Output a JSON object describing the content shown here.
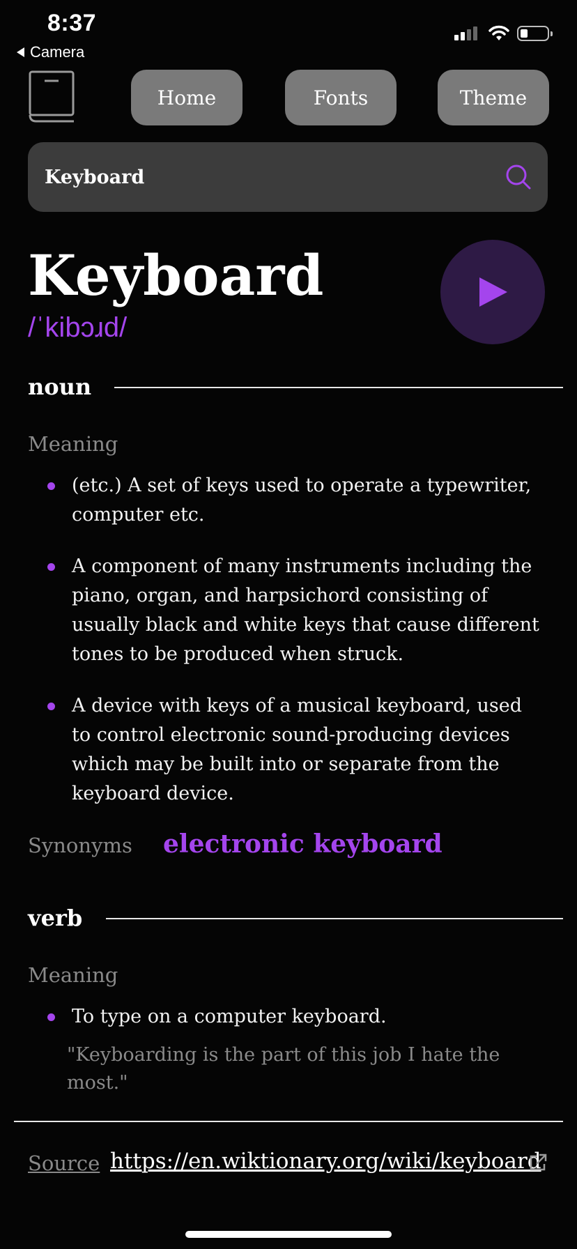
{
  "status_bar": {
    "time": "8:37",
    "back_app": "Camera"
  },
  "nav": {
    "home_label": "Home",
    "fonts_label": "Fonts",
    "theme_label": "Theme"
  },
  "search": {
    "value": "Keyboard"
  },
  "entry": {
    "word": "Keyboard",
    "phonetic": "/ˈkibɔɹd/",
    "meanings": [
      {
        "part_of_speech": "noun",
        "meaning_label": "Meaning",
        "definitions": [
          "(etc.) A set of keys used to operate a typewriter, computer etc.",
          "A component of many instruments including the piano, organ, and harpsichord consisting of usually black and white keys that cause different tones to be produced when struck.",
          "A device with keys of a musical keyboard, used to control electronic sound-producing devices which may be built into or separate from the keyboard device."
        ],
        "synonyms_label": "Synonyms",
        "synonyms": [
          "electronic keyboard"
        ]
      },
      {
        "part_of_speech": "verb",
        "meaning_label": "Meaning",
        "definitions": [
          "To type on a computer keyboard."
        ],
        "example": "\"Keyboarding is the part of this job I hate the most.\""
      }
    ]
  },
  "source": {
    "label": "Source",
    "url": "https://en.wiktionary.org/wiki/keyboard"
  },
  "colors": {
    "accent": "#a445ed",
    "background": "#050505",
    "button": "#7a7a7a",
    "search_bg": "#3c3c3c",
    "play_bg": "#2e1a45",
    "muted_text": "#8a8a8a"
  },
  "icons": [
    "book-icon",
    "search-icon",
    "play-icon",
    "external-link-icon",
    "wifi-icon",
    "battery-icon",
    "signal-icon"
  ]
}
